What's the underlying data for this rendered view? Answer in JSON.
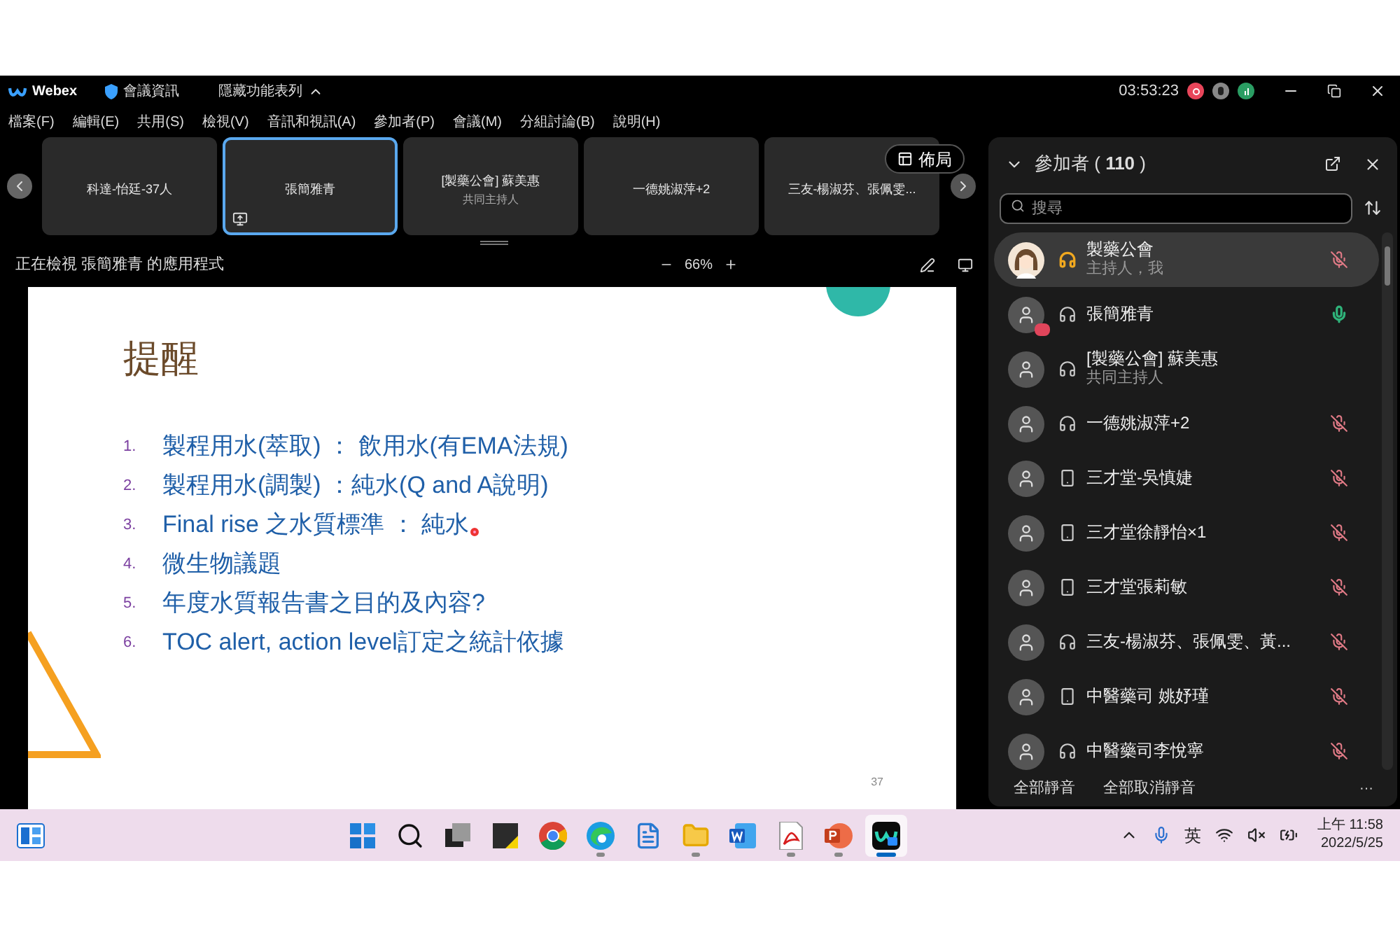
{
  "title_bar": {
    "app": "Webex",
    "meeting_info": "會議資訊",
    "hide_menu": "隱藏功能表列",
    "timer": "03:53:23"
  },
  "menu": [
    "檔案(F)",
    "編輯(E)",
    "共用(S)",
    "檢視(V)",
    "音訊和視訊(A)",
    "參加者(P)",
    "會議(M)",
    "分組討論(B)",
    "說明(H)"
  ],
  "thumbnails": [
    {
      "name": "科達-怡廷-37人",
      "selected": false,
      "sharing": false
    },
    {
      "name": "張簡雅青",
      "selected": true,
      "sharing": true
    },
    {
      "name": "[製藥公會] 蘇美惠",
      "subtitle": "共同主持人",
      "selected": false,
      "sharing": false
    },
    {
      "name": "一德姚淑萍+2",
      "selected": false,
      "sharing": false
    },
    {
      "name": "三友-楊淑芬、張佩雯...",
      "selected": false,
      "sharing": false
    }
  ],
  "layout_button": "佈局",
  "view_bar": {
    "label": "正在檢視 張簡雅青 的應用程式",
    "zoom": "66%"
  },
  "slide": {
    "title": "提醒",
    "items": [
      {
        "number": "1.",
        "text": "製程用水(萃取) ： 飲用水(有EMA法規)"
      },
      {
        "number": "2.",
        "text": "製程用水(調製) ：純水(Q and A說明)"
      },
      {
        "number": "3.",
        "text": "Final rise 之水質標準 ： 純水"
      },
      {
        "number": "4.",
        "text": "微生物議題"
      },
      {
        "number": "5.",
        "text": "年度水質報告書之目的及內容?"
      },
      {
        "number": "6.",
        "text": "TOC alert, action level訂定之統計依據"
      }
    ],
    "page": "37"
  },
  "participants_panel": {
    "title": "參加者 ( **110** )",
    "search": {
      "placeholder": "搜尋"
    },
    "participants": [
      {
        "name": "製藥公會",
        "subtitle": "主持人，我",
        "host": true,
        "phone": false,
        "muted": true,
        "selected": true
      },
      {
        "name": "張簡雅青",
        "kind": "sharing",
        "host": false,
        "phone": false,
        "muted": false,
        "selected": false
      },
      {
        "name": "[製藥公會] 蘇美惠",
        "subtitle": "共同主持人",
        "kind": "default",
        "host": false,
        "phone": false,
        "selected": false
      },
      {
        "name": "一德姚淑萍+2",
        "kind": "default",
        "host": false,
        "phone": false,
        "muted": true,
        "selected": false
      },
      {
        "name": "三才堂-吳慎婕",
        "kind": "default",
        "host": false,
        "phone": true,
        "muted": true,
        "selected": false
      },
      {
        "name": "三才堂徐靜怡×1",
        "kind": "default",
        "host": false,
        "phone": true,
        "muted": true,
        "selected": false
      },
      {
        "name": "三才堂張莉敏",
        "kind": "default",
        "host": false,
        "phone": true,
        "muted": true,
        "selected": false
      },
      {
        "name": "三友-楊淑芬、張佩雯、黃...",
        "kind": "default",
        "host": false,
        "phone": false,
        "muted": true,
        "selected": false
      },
      {
        "name": "中醫藥司 姚妤瑾",
        "kind": "default",
        "host": false,
        "phone": true,
        "muted": true,
        "selected": false
      },
      {
        "name": "中醫藥司李悅寧",
        "kind": "default",
        "host": false,
        "phone": false,
        "muted": true,
        "selected": false
      }
    ],
    "footer": [
      "全部靜音",
      "全部取消靜音"
    ],
    "more": "···"
  },
  "taskbar": {
    "apps": [
      {
        "kind": "start",
        "running": false,
        "selected": false
      },
      {
        "kind": "search",
        "running": false,
        "selected": false
      },
      {
        "kind": "taskview",
        "running": false,
        "selected": false
      },
      {
        "kind": "sticky",
        "running": false,
        "selected": false
      },
      {
        "kind": "chrome",
        "running": false,
        "selected": false
      },
      {
        "kind": "edge",
        "running": true,
        "selected": false
      },
      {
        "kind": "notepad",
        "running": false,
        "selected": false
      },
      {
        "kind": "files",
        "running": true,
        "selected": false
      },
      {
        "kind": "word",
        "running": false,
        "selected": false
      },
      {
        "kind": "acrobat",
        "running": true,
        "selected": false
      },
      {
        "kind": "powerpoint",
        "running": true,
        "selected": false
      },
      {
        "kind": "webex",
        "running": true,
        "selected": true
      }
    ],
    "ime": "英",
    "time": "上午 11:58",
    "date": "2022/5/25"
  }
}
